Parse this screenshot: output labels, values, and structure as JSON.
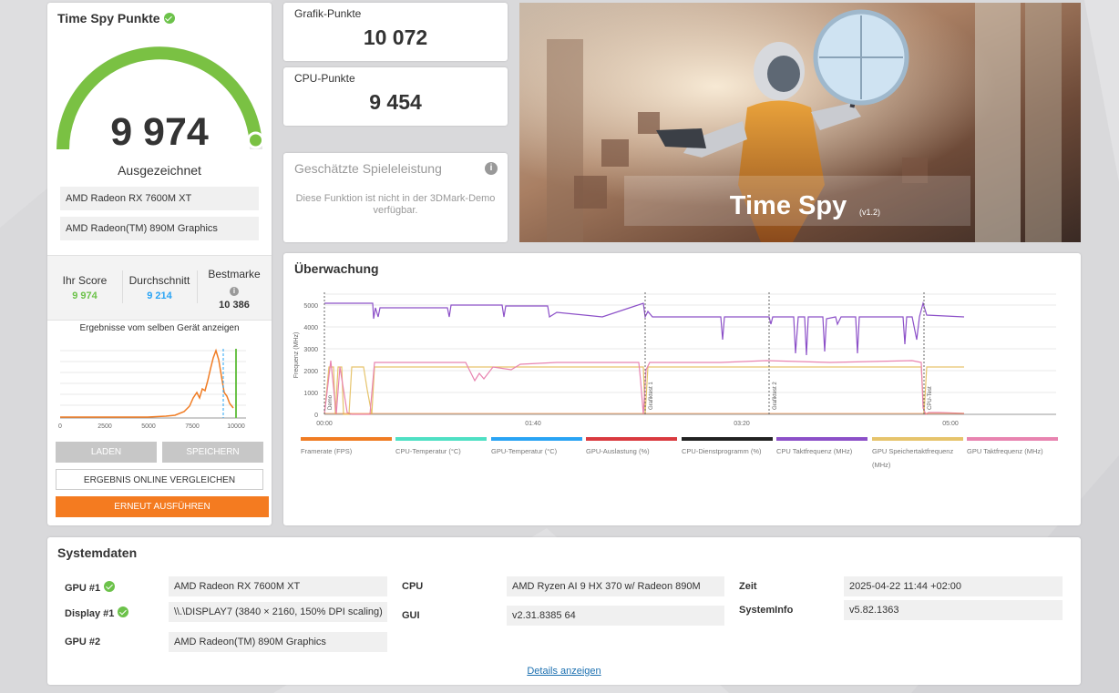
{
  "score": {
    "title": "Time Spy Punkte",
    "value": "9 974",
    "rating": "Ausgezeichnet",
    "gauge_fraction": 0.97,
    "gpus": [
      "AMD Radeon RX 7600M XT",
      "AMD Radeon(TM) 890M Graphics"
    ]
  },
  "stats": {
    "your_label": "Ihr Score",
    "your_value": "9 974",
    "avg_label": "Durchschnitt",
    "avg_value": "9 214",
    "best_label": "Bestmarke",
    "best_value": "10 386"
  },
  "distribution": {
    "title": "Ergebnisse vom selben Gerät anzeigen",
    "ticks": [
      "0",
      "2500",
      "5000",
      "7500",
      "10000"
    ]
  },
  "buttons": {
    "load": "LADEN",
    "save": "SPEICHERN",
    "compare": "ERGEBNIS ONLINE VERGLEICHEN",
    "rerun": "ERNEUT AUSFÜHREN"
  },
  "graphics": {
    "label": "Grafik-Punkte",
    "value": "10 072"
  },
  "cpu": {
    "label": "CPU-Punkte",
    "value": "9 454"
  },
  "estimated": {
    "title": "Geschätzte Spieleleistung",
    "text": "Diese Funktion ist nicht in der 3DMark-Demo verfügbar."
  },
  "hero": {
    "title": "Time Spy",
    "version": "(v1.2)"
  },
  "monitor": {
    "title": "Überwachung",
    "ylabel": "Frequenz (MHz)",
    "yticks": [
      "0",
      "1000",
      "2000",
      "3000",
      "4000",
      "5000"
    ],
    "xticks": [
      "00:00",
      "01:40",
      "03:20",
      "05:00"
    ],
    "markers": [
      "Demo",
      "Grafiktest 1",
      "Grafiktest 2",
      "CPU-Test"
    ],
    "legend": [
      {
        "label": "Framerate (FPS)",
        "color": "#f07c23"
      },
      {
        "label": "CPU-Temperatur (°C)",
        "color": "#4fe0c4"
      },
      {
        "label": "GPU-Temperatur (°C)",
        "color": "#2aa4f4"
      },
      {
        "label": "GPU-Auslastung (%)",
        "color": "#d93a3f"
      },
      {
        "label": "CPU-Dienstprogramm (%)",
        "color": "#222222"
      },
      {
        "label": "CPU Taktfrequenz (MHz)",
        "color": "#8c50c8"
      },
      {
        "label": "GPU Speichertaktfrequenz (MHz)",
        "color": "#e6c46c"
      },
      {
        "label": "GPU Taktfrequenz (MHz)",
        "color": "#e884b0"
      }
    ]
  },
  "system": {
    "title": "Systemdaten",
    "gpu1_label": "GPU #1",
    "gpu1_value": "AMD Radeon RX 7600M XT",
    "display1_label": "Display #1",
    "display1_value": "\\\\.\\DISPLAY7 (3840 × 2160, 150% DPI scaling)",
    "gpu2_label": "GPU #2",
    "gpu2_value": "AMD Radeon(TM) 890M Graphics",
    "cpu_label": "CPU",
    "cpu_value": "AMD Ryzen AI 9 HX 370 w/ Radeon 890M",
    "gui_label": "GUI",
    "gui_value": "v2.31.8385 64",
    "time_label": "Zeit",
    "time_value": "2025-04-22 11:44 +02:00",
    "sysinfo_label": "SystemInfo",
    "sysinfo_value": "v5.82.1363",
    "details_link": "Details anzeigen"
  }
}
